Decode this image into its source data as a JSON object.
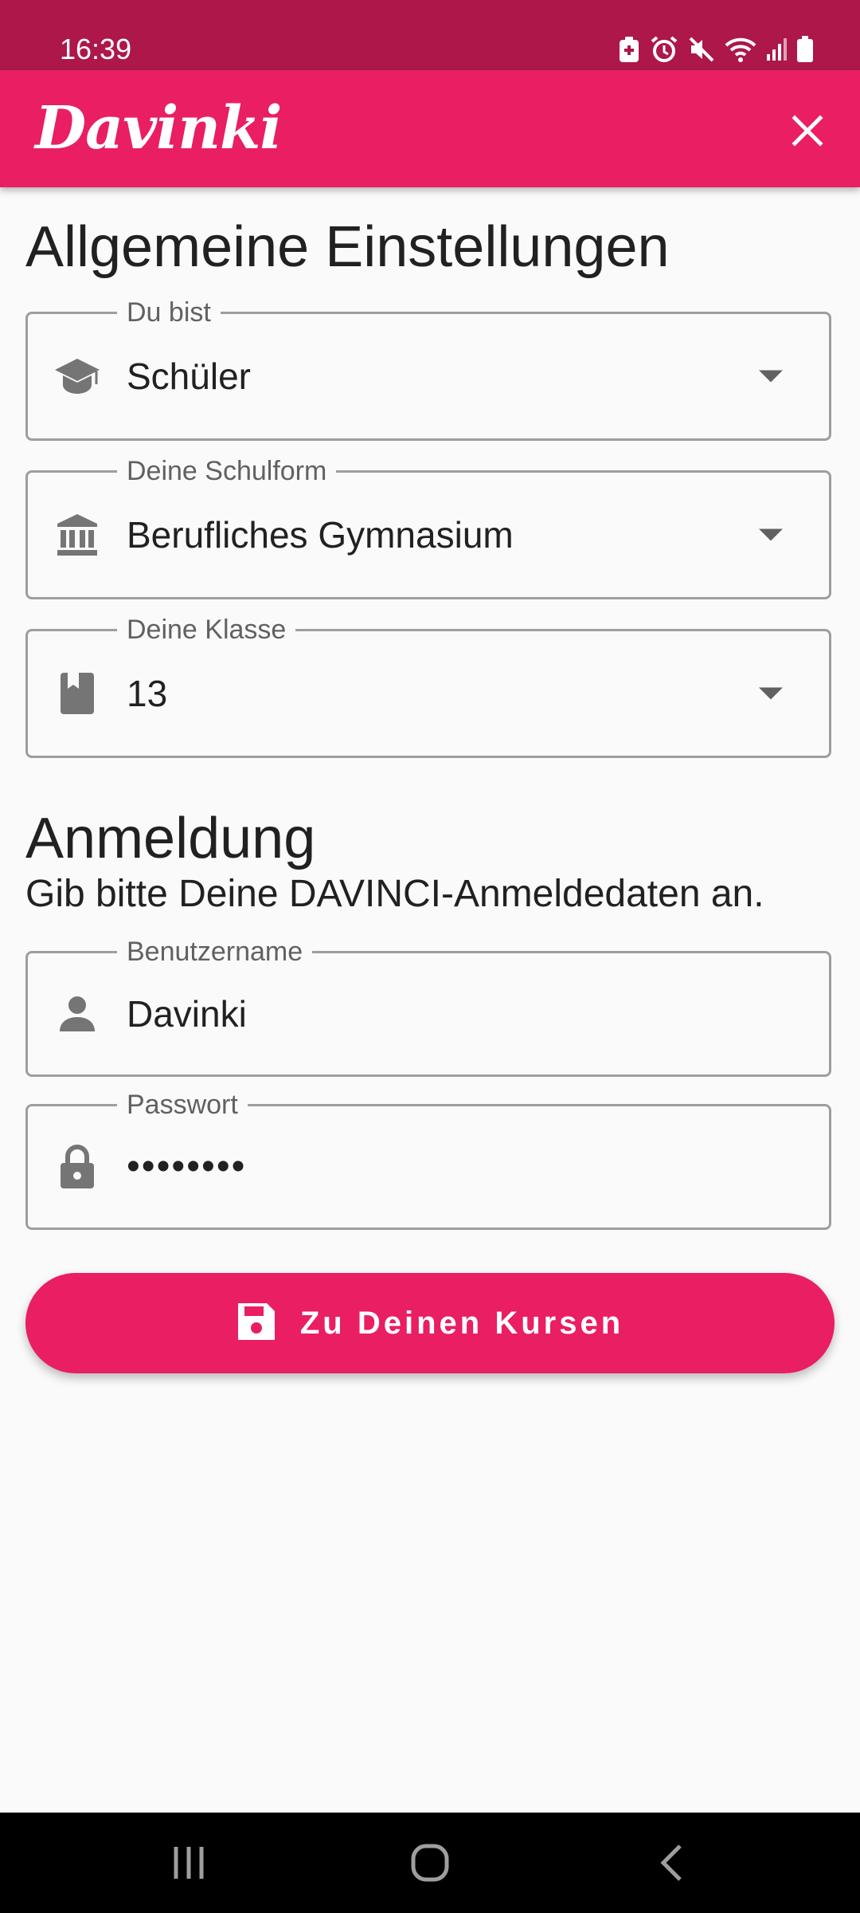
{
  "status_bar": {
    "time": "16:39",
    "icons": [
      "battery-saver-icon",
      "alarm-icon",
      "mute-icon",
      "wifi-icon",
      "signal-icon",
      "battery-icon"
    ]
  },
  "app_bar": {
    "title": "Davinki",
    "close_icon": "close-icon"
  },
  "general_settings": {
    "heading": "Allgemeine Einstellungen",
    "role": {
      "label": "Du bist",
      "value": "Schüler",
      "icon": "school-icon"
    },
    "school_type": {
      "label": "Deine Schulform",
      "value": "Berufliches Gymnasium",
      "icon": "institution-icon"
    },
    "grade": {
      "label": "Deine Klasse",
      "value": "13",
      "icon": "bookmark-book-icon"
    }
  },
  "login": {
    "heading": "Anmeldung",
    "subtitle": "Gib bitte Deine DAVINCI-Anmeldedaten an.",
    "username": {
      "label": "Benutzername",
      "value": "Davinki",
      "icon": "person-icon"
    },
    "password": {
      "label": "Passwort",
      "value": "••••••••",
      "icon": "lock-icon"
    }
  },
  "submit_button": {
    "label": "Zu Deinen Kursen",
    "icon": "save-icon"
  },
  "colors": {
    "primary": "#e91e63",
    "status_bar": "#ad1749",
    "background": "#fafafa",
    "outline": "#9e9e9e",
    "icon_grey": "#757575"
  },
  "nav_bar": {
    "buttons": [
      "recent-apps-icon",
      "home-icon",
      "back-icon"
    ]
  }
}
